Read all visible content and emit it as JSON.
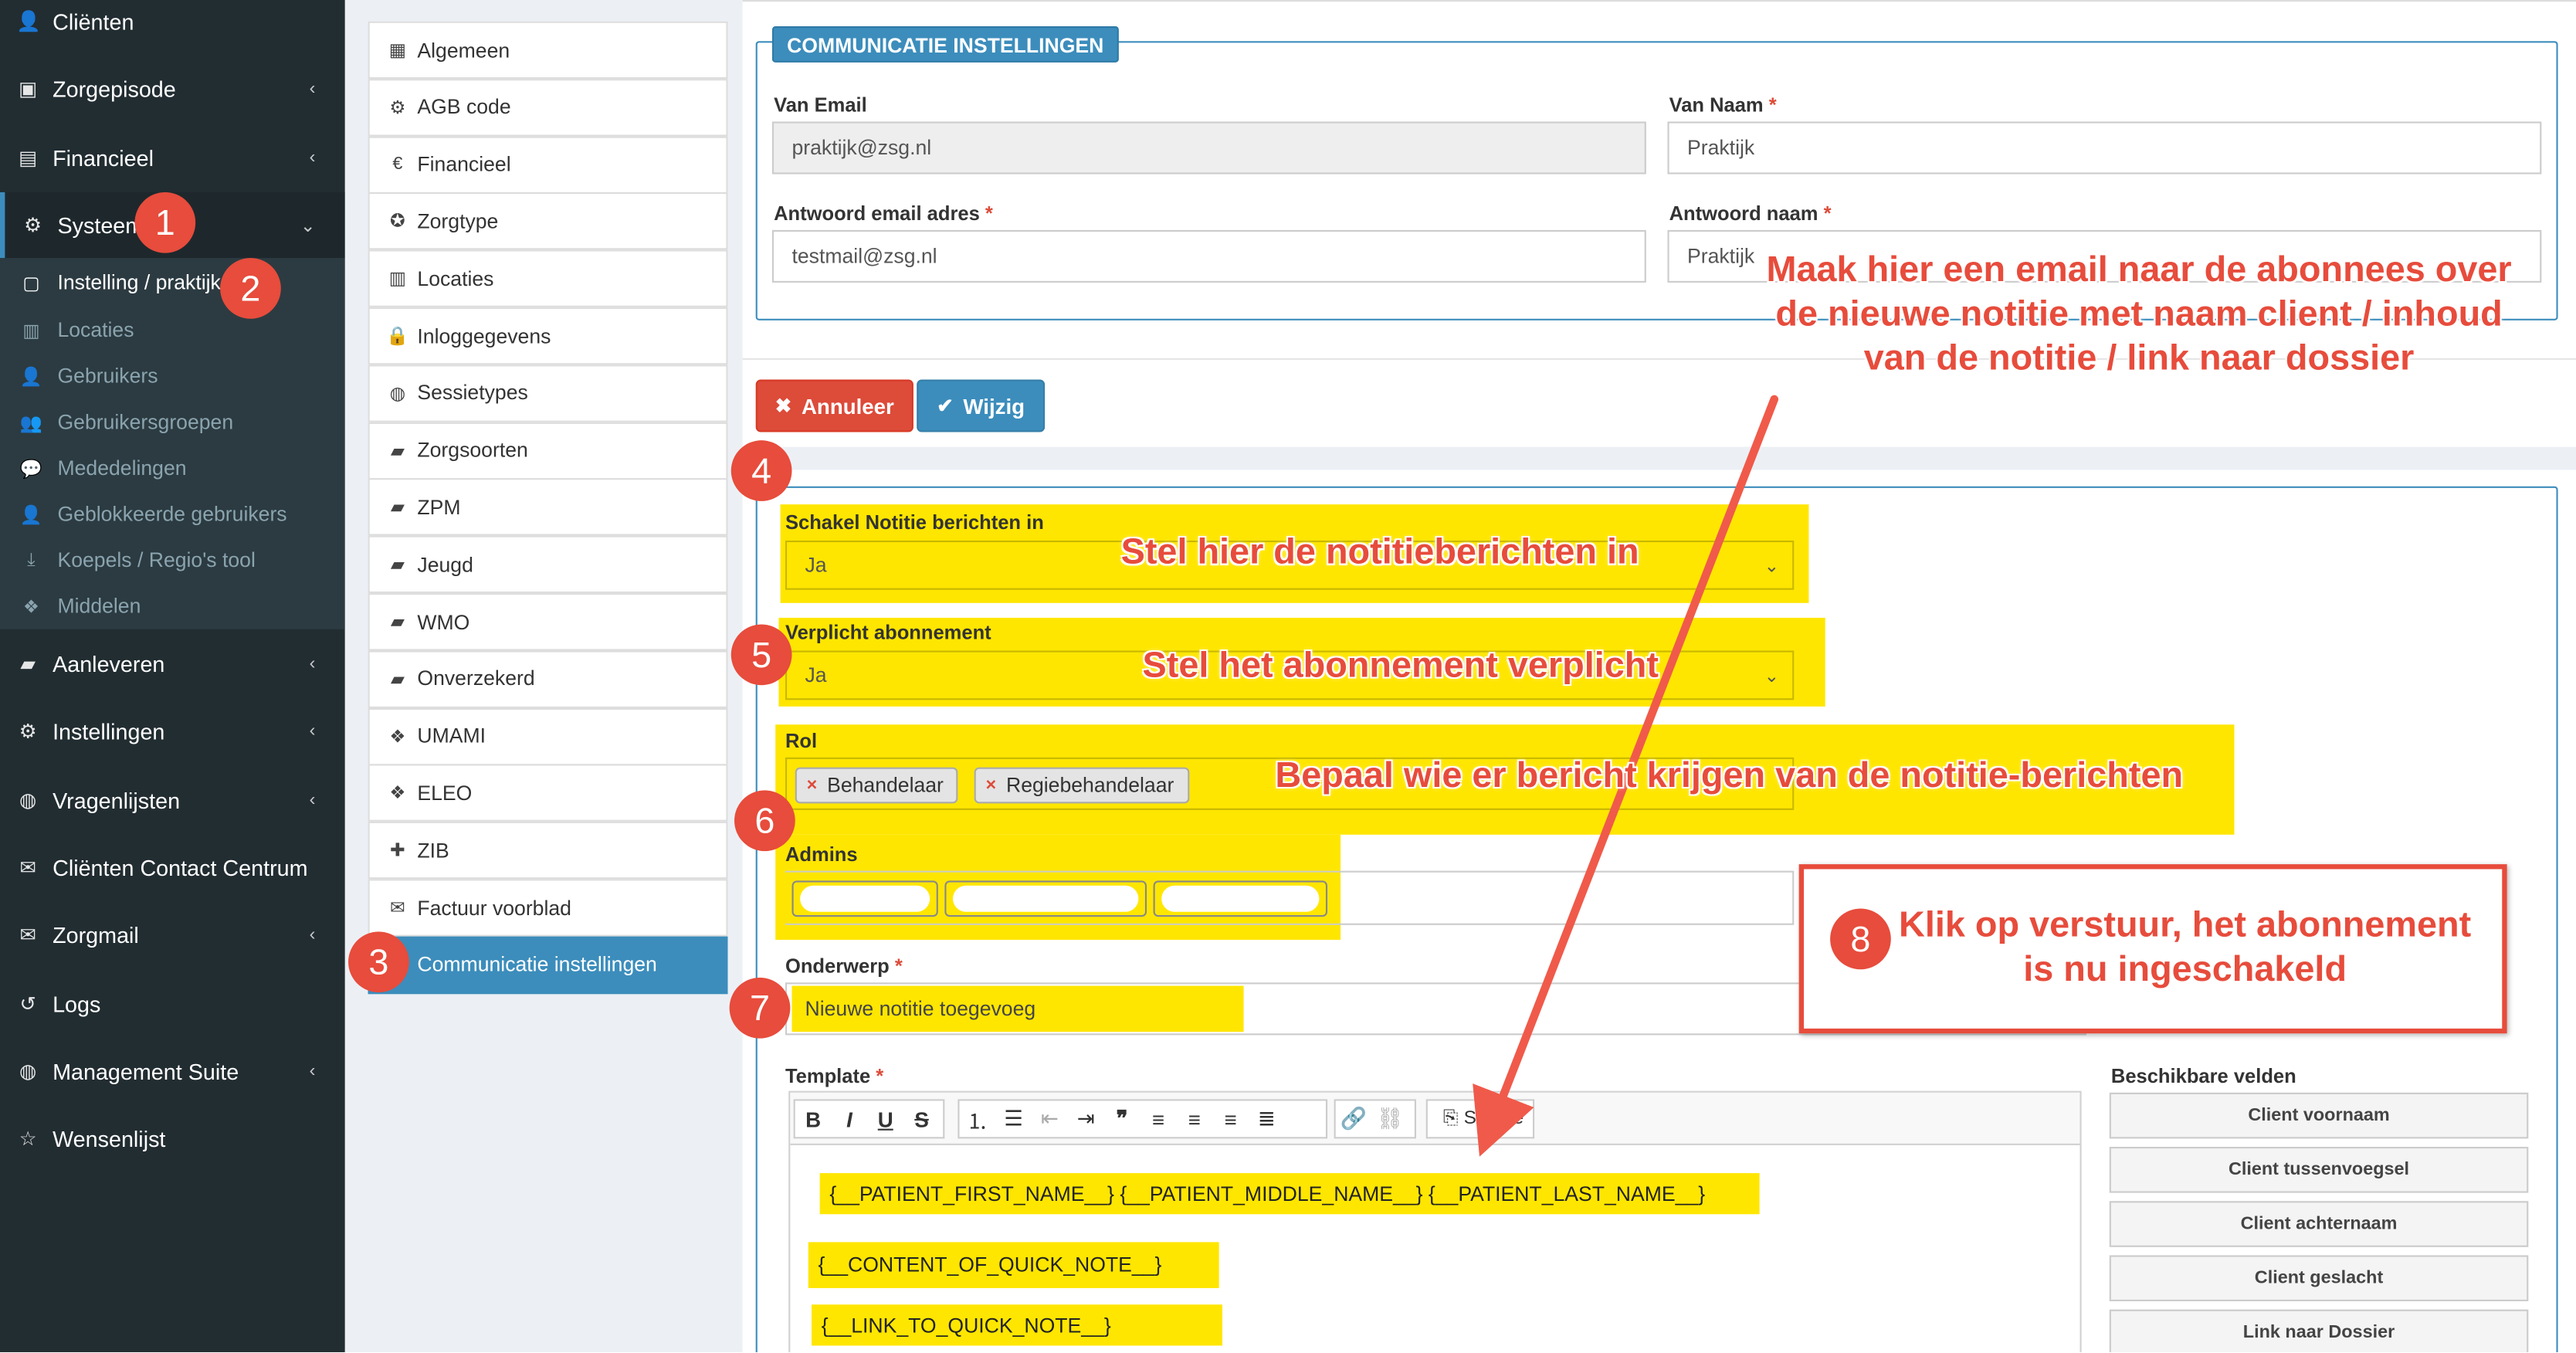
{
  "sidebar": {
    "items": [
      {
        "label": "Cliënten",
        "icon": "user-icon",
        "glyph": "👤"
      },
      {
        "label": "Zorgepisode",
        "icon": "briefcase-icon",
        "glyph": "▣"
      },
      {
        "label": "Financieel",
        "icon": "book-icon",
        "glyph": "▤"
      },
      {
        "label": "Systeem",
        "icon": "cogs-icon",
        "glyph": "⚙"
      },
      {
        "label": "Aanleveren",
        "icon": "truck-icon",
        "glyph": "▰"
      },
      {
        "label": "Instellingen",
        "icon": "gear-icon",
        "glyph": "⚙"
      },
      {
        "label": "Vragenlijsten",
        "icon": "globe-icon",
        "glyph": "◍"
      },
      {
        "label": "Cliënten Contact Centrum",
        "icon": "envelope-icon",
        "glyph": "✉"
      },
      {
        "label": "Zorgmail",
        "icon": "envelope-icon",
        "glyph": "✉"
      },
      {
        "label": "Logs",
        "icon": "history-icon",
        "glyph": "↺"
      },
      {
        "label": "Management Suite",
        "icon": "globe-icon",
        "glyph": "◍"
      },
      {
        "label": "Wensenlijst",
        "icon": "star-icon",
        "glyph": "☆"
      }
    ],
    "sub_items": [
      {
        "label": "Instelling / praktijk",
        "icon": "clipboard-icon",
        "glyph": "▢"
      },
      {
        "label": "Locaties",
        "icon": "map-icon",
        "glyph": "▥"
      },
      {
        "label": "Gebruikers",
        "icon": "user-icon",
        "glyph": "👤"
      },
      {
        "label": "Gebruikersgroepen",
        "icon": "users-icon",
        "glyph": "👥"
      },
      {
        "label": "Mededelingen",
        "icon": "comments-icon",
        "glyph": "💬"
      },
      {
        "label": "Geblokkeerde gebruikers",
        "icon": "user-times-icon",
        "glyph": "👤"
      },
      {
        "label": "Koepels / Regio's tool",
        "icon": "download-icon",
        "glyph": "⤓"
      },
      {
        "label": "Middelen",
        "icon": "cubes-icon",
        "glyph": "❖"
      }
    ]
  },
  "settings_menu": {
    "items": [
      {
        "label": "Algemeen",
        "icon": "table-icon",
        "glyph": "▦"
      },
      {
        "label": "AGB code",
        "icon": "cogs-icon",
        "glyph": "⚙"
      },
      {
        "label": "Financieel",
        "icon": "euro-icon",
        "glyph": "€"
      },
      {
        "label": "Zorgtype",
        "icon": "universal-access-icon",
        "glyph": "✪"
      },
      {
        "label": "Locaties",
        "icon": "map-icon",
        "glyph": "▥"
      },
      {
        "label": "Inloggegevens",
        "icon": "lock-icon",
        "glyph": "🔒"
      },
      {
        "label": "Sessietypes",
        "icon": "globe-icon",
        "glyph": "◍"
      },
      {
        "label": "Zorgsoorten",
        "icon": "briefcase-icon",
        "glyph": "▰"
      },
      {
        "label": "ZPM",
        "icon": "briefcase-icon",
        "glyph": "▰"
      },
      {
        "label": "Jeugd",
        "icon": "briefcase-icon",
        "glyph": "▰"
      },
      {
        "label": "WMO",
        "icon": "briefcase-icon",
        "glyph": "▰"
      },
      {
        "label": "Onverzekerd",
        "icon": "briefcase-icon",
        "glyph": "▰"
      },
      {
        "label": "UMAMI",
        "icon": "cubes-icon",
        "glyph": "❖"
      },
      {
        "label": "ELEO",
        "icon": "cubes-icon",
        "glyph": "❖"
      },
      {
        "label": "ZIB",
        "icon": "puzzle-icon",
        "glyph": "✚"
      },
      {
        "label": "Factuur voorblad",
        "icon": "envelope-icon",
        "glyph": "✉"
      },
      {
        "label": "Communicatie instellingen",
        "icon": "",
        "glyph": ""
      }
    ]
  },
  "comm": {
    "legend": "COMMUNICATIE INSTELLINGEN",
    "van_email_label": "Van Email",
    "van_email_value": "praktijk@zsg.nl",
    "van_naam_label": "Van Naam",
    "van_naam_value": "Praktijk",
    "antwoord_email_label": "Antwoord email adres",
    "antwoord_email_value": "testmail@zsg.nl",
    "antwoord_naam_label": "Antwoord naam",
    "antwoord_naam_value": "Praktijk",
    "required_mark": "*"
  },
  "buttons": {
    "cancel": "Annuleer",
    "save": "Wijzig"
  },
  "notes": {
    "schakel_label": "Schakel Notitie berichten in",
    "schakel_value": "Ja",
    "verplicht_label": "Verplicht abonnement",
    "verplicht_value": "Ja",
    "rol_label": "Rol",
    "roles": [
      "Behandelaar",
      "Regiebehandelaar"
    ],
    "tag_remove": "×",
    "admins_label": "Admins",
    "onderwerp_label": "Onderwerp",
    "onderwerp_value": "Nieuwe notitie toegevoeg",
    "template_label": "Template",
    "source_label": "Source",
    "template_lines": [
      "{__PATIENT_FIRST_NAME__} {__PATIENT_MIDDLE_NAME__} {__PATIENT_LAST_NAME__}",
      "{__CONTENT_OF_QUICK_NOTE__}",
      "{__LINK_TO_QUICK_NOTE__}"
    ],
    "fields_label": "Beschikbare velden",
    "fields": [
      "Client voornaam",
      "Client tussenvoegsel",
      "Client achternaam",
      "Client geslacht",
      "Link naar Dossier"
    ]
  },
  "annotations": {
    "email_note": "Maak hier een email naar de abonnees over de nieuwe notitie met naam client / inhoud van de notitie / link naar dossier",
    "schakel_note": "Stel hier de notitieberichten in",
    "verplicht_note": "Stel het abonnement verplicht",
    "rol_note": "Bepaal wie er bericht krijgen van de notitie-berichten",
    "submit_note": "Klik op verstuur, het abonnement is nu ingeschakeld",
    "badges": [
      "1",
      "2",
      "3",
      "4",
      "5",
      "6",
      "7",
      "8"
    ]
  },
  "colors": {
    "sidebar_bg": "#222d32",
    "accent": "#3c8dbc",
    "danger": "#dd4b39",
    "highlight": "#ffe600",
    "annotation": "#e74c3c"
  }
}
